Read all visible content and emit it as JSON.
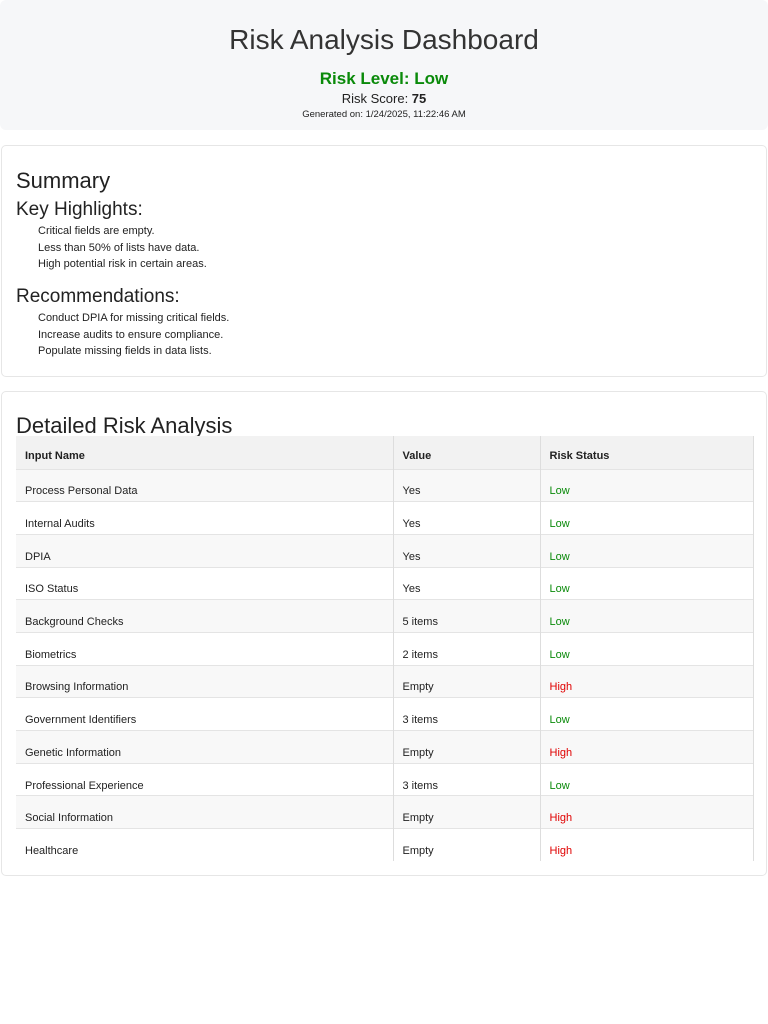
{
  "header": {
    "title": "Risk Analysis Dashboard",
    "risk_level": "Risk Level: Low",
    "risk_score_label": "Risk Score: ",
    "risk_score": "75",
    "generated": "Generated on: 1/24/2025, 11:22:46 AM"
  },
  "summary": {
    "title": "Summary",
    "highlights_title": "Key Highlights:",
    "highlights": [
      "Critical fields are empty.",
      "Less than 50% of lists have data.",
      "High potential risk in certain areas."
    ],
    "recommendations_title": "Recommendations:",
    "recommendations": [
      "Conduct DPIA for missing critical fields.",
      "Increase audits to ensure compliance.",
      "Populate missing fields in data lists."
    ]
  },
  "detail": {
    "title": "Detailed Risk Analysis",
    "columns": [
      "Input Name",
      "Value",
      "Risk Status"
    ],
    "rows": [
      [
        "Process Personal Data",
        "Yes",
        "Low"
      ],
      [
        "Internal Audits",
        "Yes",
        "Low"
      ],
      [
        "DPIA",
        "Yes",
        "Low"
      ],
      [
        "ISO Status",
        "Yes",
        "Low"
      ],
      [
        "Background Checks",
        "5 items",
        "Low"
      ],
      [
        "Biometrics",
        "2 items",
        "Low"
      ],
      [
        "Browsing Information",
        "Empty",
        "High"
      ],
      [
        "Government Identifiers",
        "3 items",
        "Low"
      ],
      [
        "Genetic Information",
        "Empty",
        "High"
      ],
      [
        "Professional Experience",
        "3 items",
        "Low"
      ],
      [
        "Social Information",
        "Empty",
        "High"
      ],
      [
        "Healthcare",
        "Empty",
        "High"
      ]
    ]
  },
  "colors": {
    "low": "#0a8a0a",
    "high": "#e00000"
  }
}
